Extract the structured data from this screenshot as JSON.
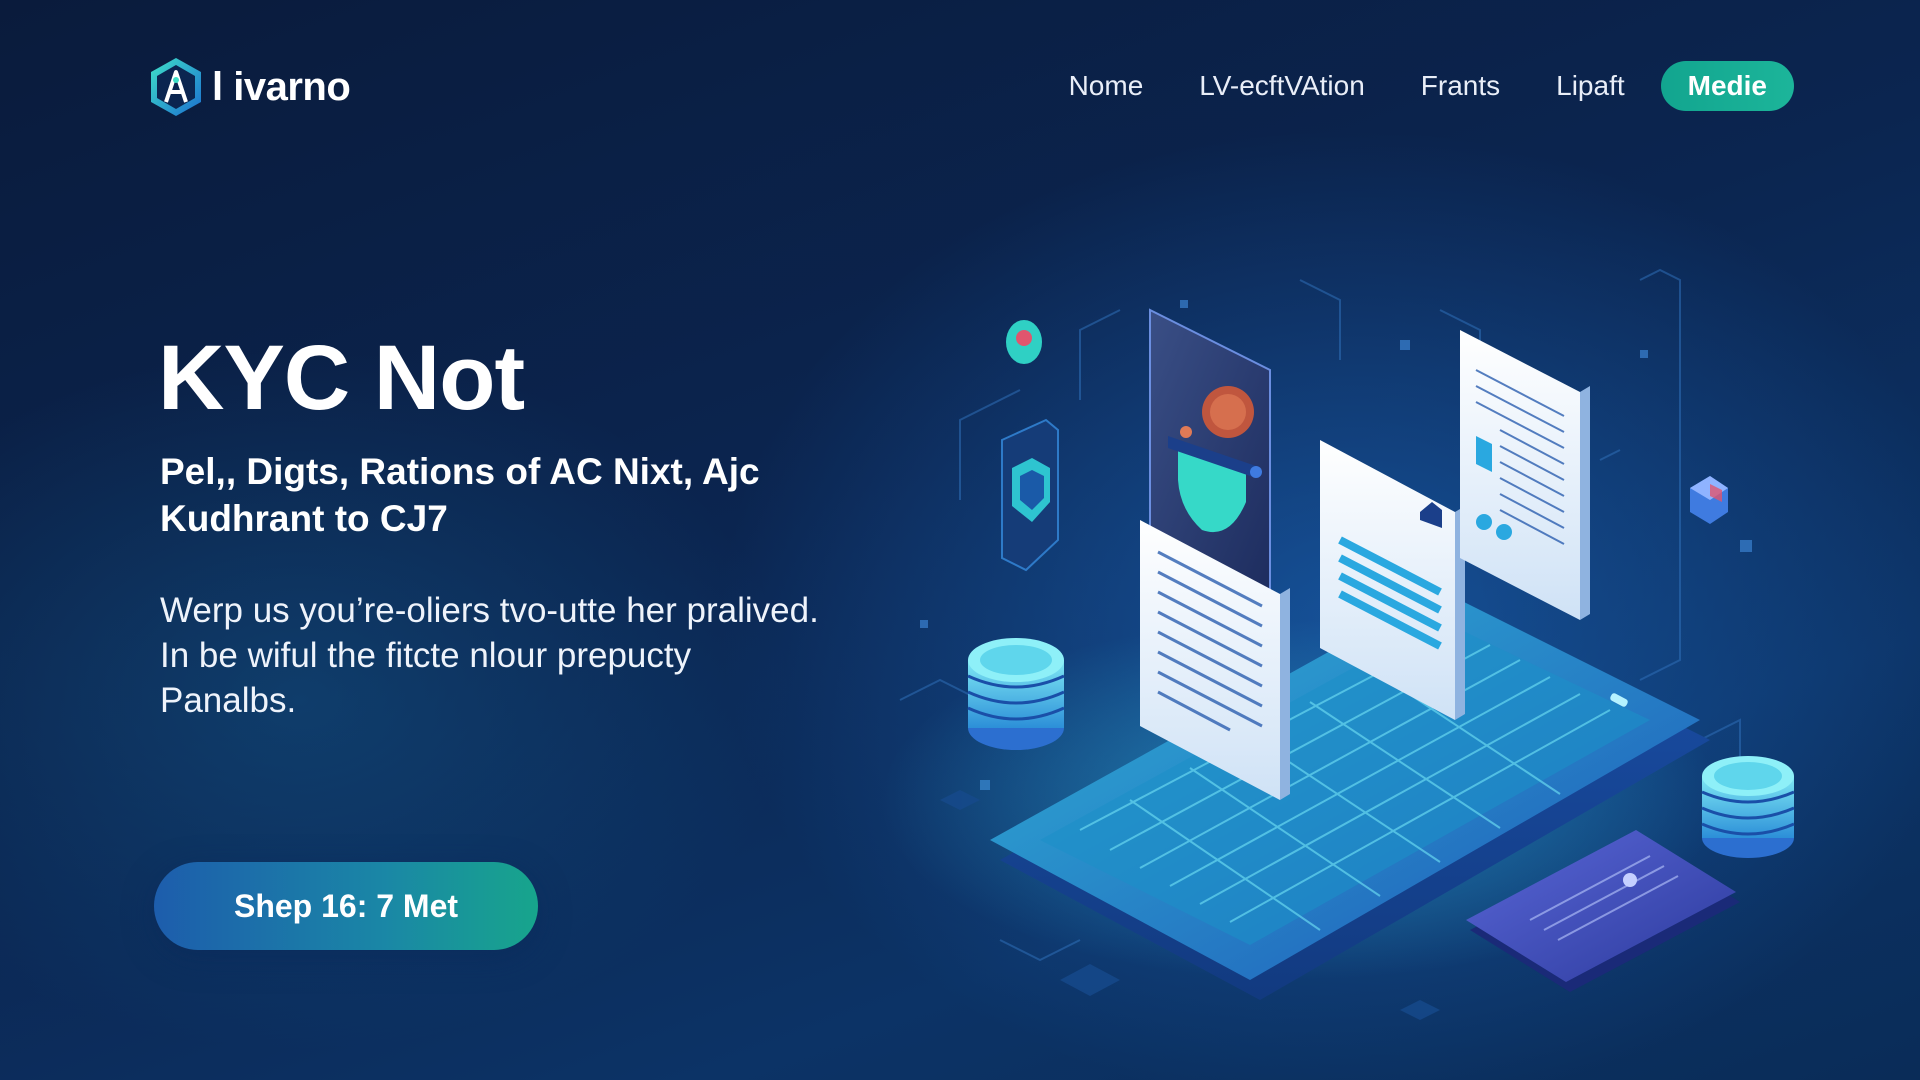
{
  "brand": {
    "name": "l ivarno",
    "logo_icon": "ai-hexagon-icon"
  },
  "nav": {
    "links": [
      {
        "label": "Nome"
      },
      {
        "label": "LV-ecftVAtion"
      },
      {
        "label": "Frants"
      },
      {
        "label": "Lipaft"
      }
    ],
    "cta_label": "Medie"
  },
  "hero": {
    "title": "KYC Not",
    "subtitle": "Pel,, Digts, Rations of AC Nixt, Ajc Kudhrant to CJ7",
    "body": "Werp us you’re-oliers tvo-utte her pralived. In be wiful the fitcte nlour prepucty Panalbs.",
    "cta_label": "Shep 16: 7 Met"
  },
  "illustration": {
    "description_icons": [
      "laptop-icon",
      "shield-icon",
      "document-icon",
      "face-id-icon",
      "coin-stack-icon",
      "id-card-icon",
      "cube-icon"
    ]
  },
  "colors": {
    "background": "#0b2550",
    "accent": "#1cb59a",
    "cta_gradient_start": "#1d5dac",
    "cta_gradient_end": "#17a58c"
  }
}
